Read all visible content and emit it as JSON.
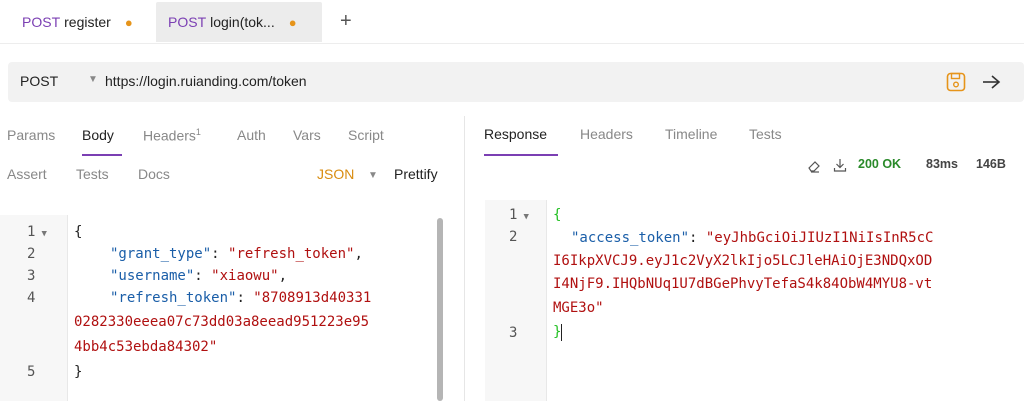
{
  "tabs": [
    {
      "method": "POST",
      "name": "register",
      "unsaved": "●"
    },
    {
      "method": "POST",
      "name": "login(tok...",
      "unsaved": "●"
    }
  ],
  "new_tab": "+",
  "url_bar": {
    "method": "POST",
    "caret": "▼",
    "url": "https://login.ruianding.com/token",
    "save_icon": "save-icon",
    "send_icon": "send-arrow-icon",
    "save_color": "#e6941a"
  },
  "request_tabs": {
    "params": "Params",
    "body": "Body",
    "headers": "Headers",
    "headers_count": "1",
    "auth": "Auth",
    "vars": "Vars",
    "script": "Script",
    "assert": "Assert",
    "tests": "Tests",
    "docs": "Docs"
  },
  "body_format": {
    "value": "JSON",
    "caret": "▼",
    "prettify": "Prettify"
  },
  "request_body": {
    "line_numbers": [
      "1",
      "2",
      "3",
      "4",
      "5"
    ],
    "fold": "▼",
    "open_brace": "{",
    "close_brace": "}",
    "grant_type_key": "\"grant_type\"",
    "grant_type_value": "\"refresh_token\"",
    "username_key": "\"username\"",
    "username_value": "\"xiaowu\"",
    "refresh_token_key": "\"refresh_token\"",
    "refresh_token_value_1": "\"8708913d40331",
    "refresh_token_value_2": "0282330eeea07c73dd03a8eead951223e95",
    "refresh_token_value_3": "4bb4c53ebda84302\""
  },
  "response_tabs": {
    "response": "Response",
    "headers": "Headers",
    "timeline": "Timeline",
    "tests": "Tests"
  },
  "response_status": {
    "clear_icon": "eraser-icon",
    "download_icon": "download-icon",
    "status": "200 OK",
    "time": "83ms",
    "size": "146B",
    "status_color": "#2a8a2a"
  },
  "response_body": {
    "line_numbers": [
      "1",
      "2",
      "3"
    ],
    "fold": "▼",
    "open_brace": "{",
    "close_brace": "}",
    "access_token_key": "\"access_token\"",
    "access_token_value_1": "\"eyJhbGciOiJIUzI1NiIsInR5cC",
    "access_token_value_2": "I6IkpXVCJ9.eyJ1c2VyX2lkIjo5LCJleHAiOjE3NDQxOD",
    "access_token_value_3": "I4NjF9.IHQbNUq1U7dBGePhvyTefaS4k84ObW4MYU8-vt",
    "access_token_value_4": "MGE3o\""
  }
}
